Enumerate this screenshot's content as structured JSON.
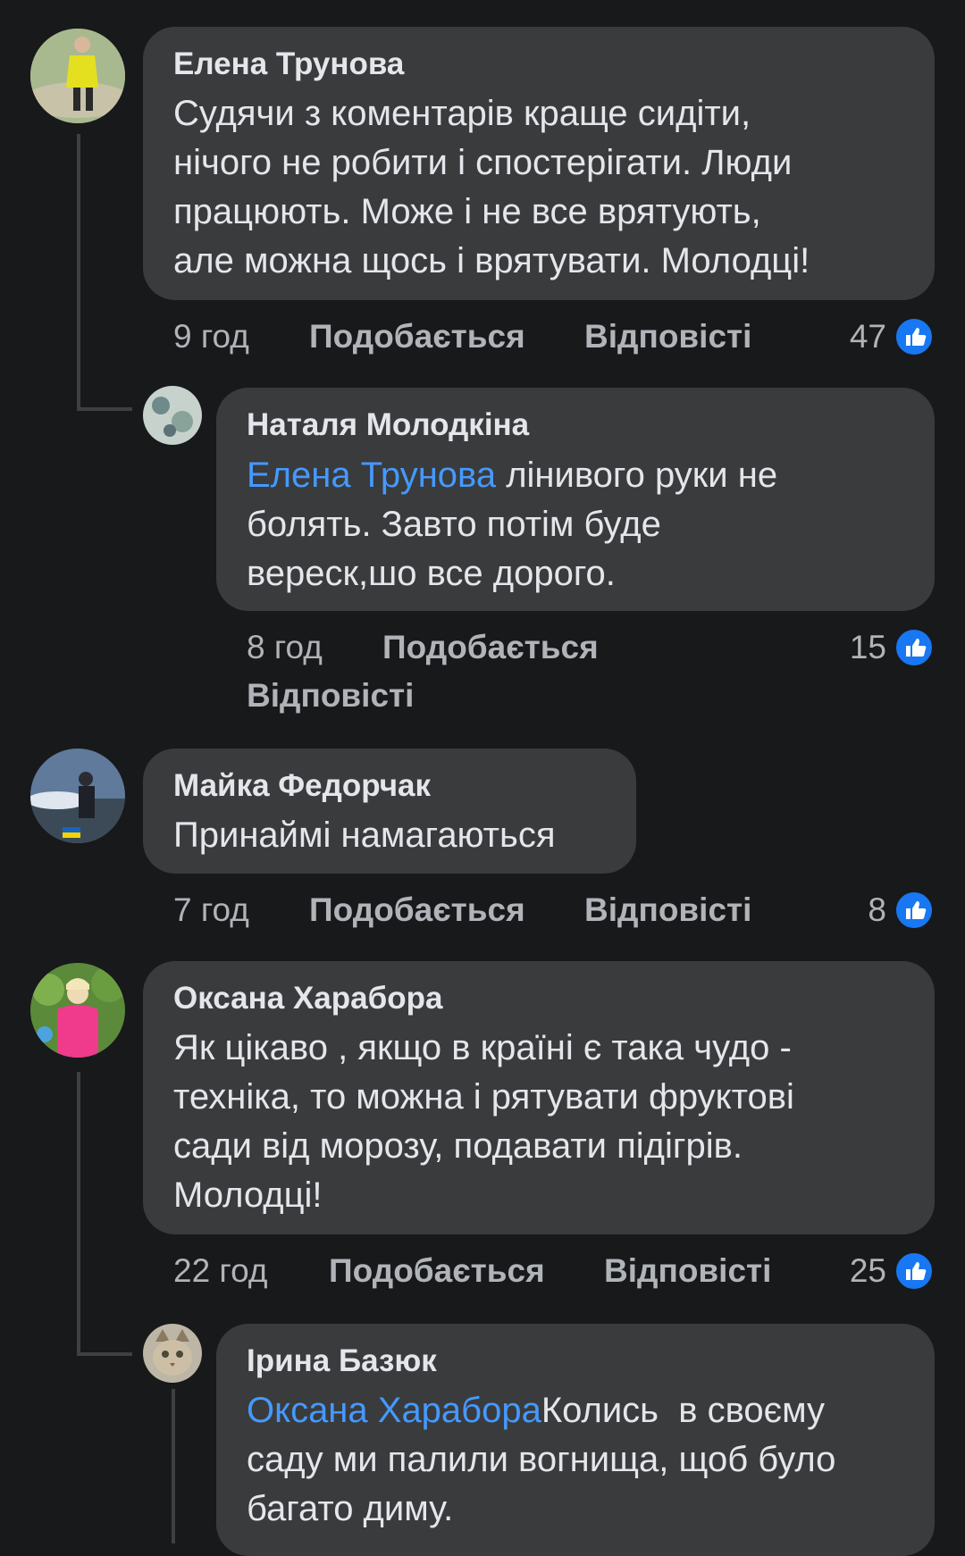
{
  "colors": {
    "background": "#18191a",
    "bubble": "#3a3b3c",
    "mention": "#4599ff",
    "meta": "#b0b3b8",
    "like_badge": "#1877f2"
  },
  "comments": [
    {
      "author": "Елена Трунова",
      "lines": [
        "Судячи з коментарів краще сидіти,",
        "нічого не робити і спостерігати. Люди",
        "працюють. Може і не все врятують,",
        "але можна щось і врятувати. Молодці!"
      ],
      "time": "9 год",
      "like_label": "Подобається",
      "reply_label": "Відповісті",
      "reactions": "47",
      "reaction_icon": "thumbs-up-icon"
    },
    {
      "author": "Наталя Молодкіна",
      "mention": "Елена Трунова",
      "lines": [
        " лінивого руки не",
        "болять. Завто потім буде",
        "вереск,шо все дорого."
      ],
      "time": "8 год",
      "like_label": "Подобається",
      "reply_label": "Відповісті",
      "reactions": "15",
      "reaction_icon": "thumbs-up-icon"
    },
    {
      "author": "Майка Федорчак",
      "lines": [
        "Принаймі намагаються"
      ],
      "time": "7 год",
      "like_label": "Подобається",
      "reply_label": "Відповісті",
      "reactions": "8",
      "reaction_icon": "thumbs-up-icon"
    },
    {
      "author": "Оксана Харабора",
      "lines": [
        "Як цікаво , якщо в країні є така чудо -",
        "техніка, то можна і рятувати фруктові",
        "сади від морозу, подавати підігрів.",
        "Молодці!"
      ],
      "time": "22 год",
      "like_label": "Подобається",
      "reply_label": "Відповісті",
      "reactions": "25",
      "reaction_icon": "thumbs-up-icon"
    },
    {
      "author": "Ірина Базюк",
      "mention": "Оксана Харабора",
      "lines": [
        "Колись  в своєму",
        "саду ми палили вогнища, щоб було",
        "багато диму."
      ]
    }
  ]
}
